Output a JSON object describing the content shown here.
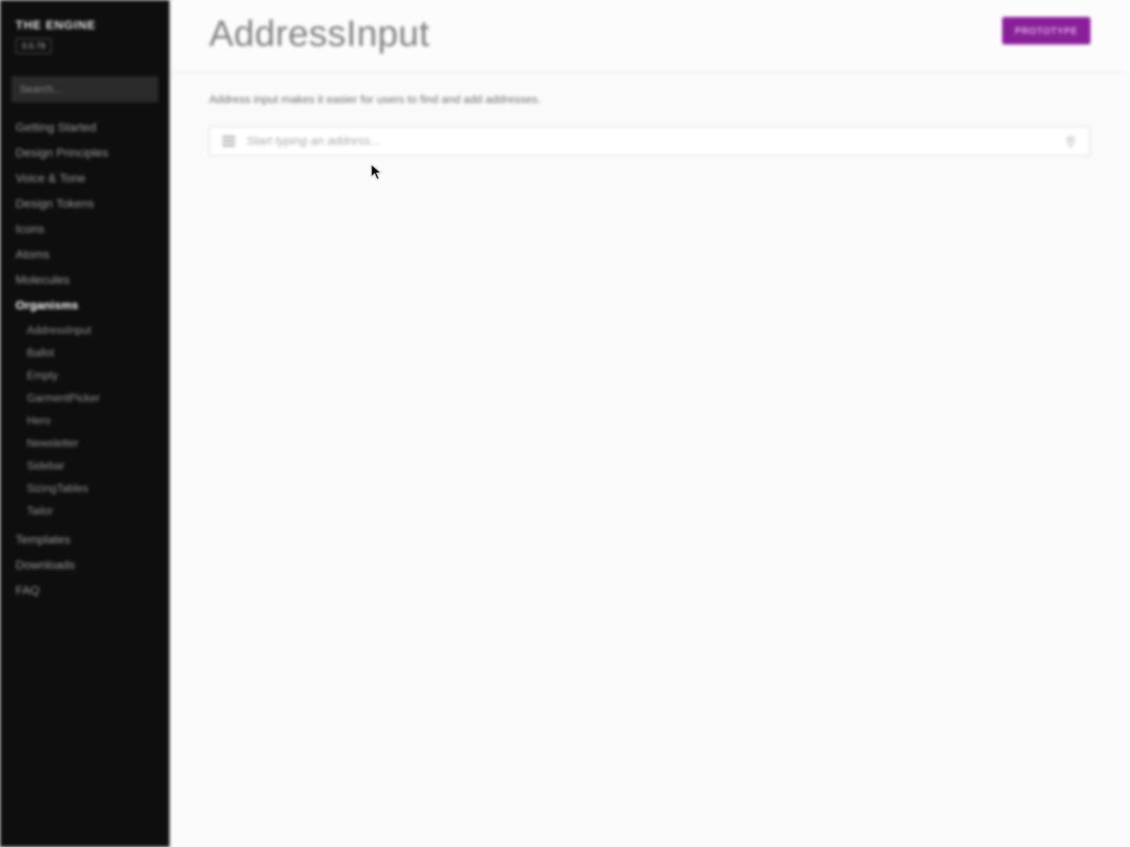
{
  "brand": {
    "title": "THE ENGINE",
    "version": "0.0.78"
  },
  "sidebar": {
    "search_placeholder": "Search...",
    "items": [
      {
        "label": "Getting Started"
      },
      {
        "label": "Design Principles"
      },
      {
        "label": "Voice & Tone"
      },
      {
        "label": "Design Tokens"
      },
      {
        "label": "Icons"
      },
      {
        "label": "Atoms"
      },
      {
        "label": "Molecules"
      },
      {
        "label": "Organisms",
        "active": true,
        "children": [
          {
            "label": "AddressInput"
          },
          {
            "label": "Ballot"
          },
          {
            "label": "Empty"
          },
          {
            "label": "GarmentPicker"
          },
          {
            "label": "Hero"
          },
          {
            "label": "Newsletter"
          },
          {
            "label": "Sidebar"
          },
          {
            "label": "SizingTables"
          },
          {
            "label": "Tailor"
          }
        ]
      },
      {
        "label": "Templates"
      },
      {
        "label": "Downloads"
      },
      {
        "label": "FAQ"
      }
    ]
  },
  "header": {
    "title": "AddressInput",
    "button": "PROTOTYPE"
  },
  "page": {
    "intro": "Address input makes it easier for users to find and add addresses.",
    "address_placeholder": "Start typing an address..."
  },
  "colors": {
    "accent": "#8a1f9a"
  }
}
